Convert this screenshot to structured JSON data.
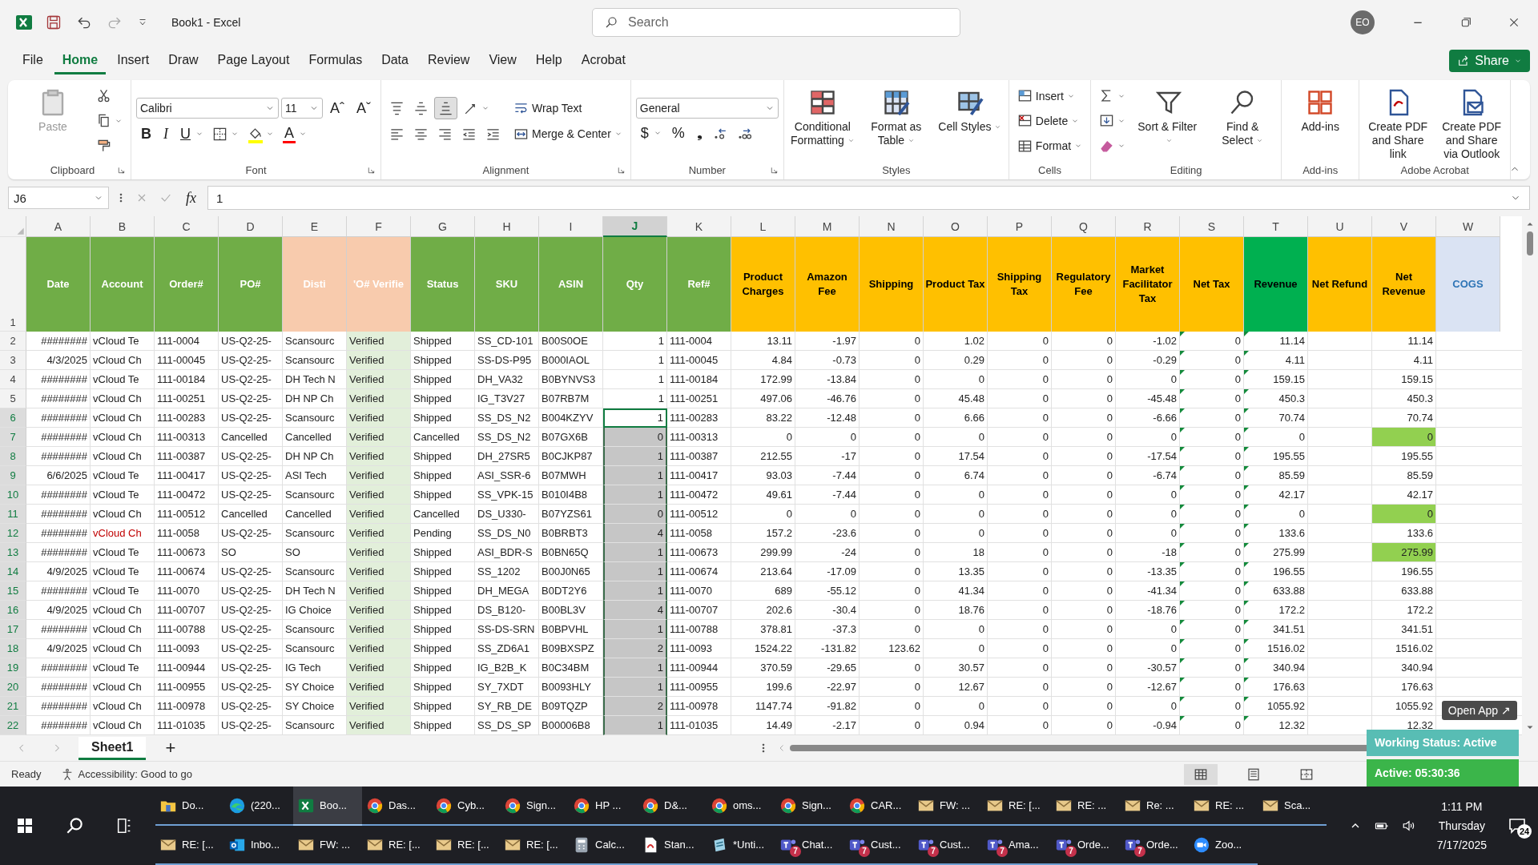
{
  "window": {
    "title": "Book1  -  Excel",
    "search_placeholder": "Search",
    "avatar": "EO"
  },
  "menu_tabs": [
    {
      "label": "File",
      "selected": false
    },
    {
      "label": "Home",
      "selected": true
    },
    {
      "label": "Insert",
      "selected": false
    },
    {
      "label": "Draw",
      "selected": false
    },
    {
      "label": "Page Layout",
      "selected": false
    },
    {
      "label": "Formulas",
      "selected": false
    },
    {
      "label": "Data",
      "selected": false
    },
    {
      "label": "Review",
      "selected": false
    },
    {
      "label": "View",
      "selected": false
    },
    {
      "label": "Help",
      "selected": false
    },
    {
      "label": "Acrobat",
      "selected": false
    }
  ],
  "share_button": "Share",
  "ribbon": {
    "groups": [
      {
        "label": "Clipboard",
        "launcher": true,
        "columns": [
          [
            {
              "kind": "clipboard",
              "label": "Paste",
              "disabled": true
            }
          ],
          [
            {
              "kind": "scissors"
            },
            {
              "kind": "copy",
              "dropdown": true
            },
            {
              "kind": "brush"
            }
          ]
        ]
      },
      {
        "label": "Font",
        "launcher": true,
        "columns": [
          [
            {
              "kind": "row",
              "items": [
                {
                  "kind": "field",
                  "value": "Calibri"
                },
                {
                  "kind": "field",
                  "value": "11"
                },
                {
                  "kind": "grow-font",
                  "glyph": "Aˆ"
                },
                {
                  "kind": "shrink-font",
                  "glyph": "Aˇ"
                }
              ]
            },
            {
              "kind": "row",
              "items": [
                {
                  "kind": "bold",
                  "glyph": "B"
                },
                {
                  "kind": "italic",
                  "glyph": "I"
                },
                {
                  "kind": "underline",
                  "glyph": "U",
                  "dropdown": true
                },
                {
                  "kind": "borders",
                  "dropdown": true
                },
                {
                  "kind": "bucket",
                  "dropdown": true,
                  "color": "#ffff00"
                },
                {
                  "kind": "font-color",
                  "glyph": "A",
                  "dropdown": true,
                  "color": "#ff0000"
                }
              ]
            }
          ]
        ]
      },
      {
        "label": "Alignment",
        "launcher": true,
        "columns": [
          [
            {
              "kind": "row",
              "items": [
                {
                  "kind": "align-top",
                  "pressed": false
                },
                {
                  "kind": "align-middle",
                  "pressed": false
                },
                {
                  "kind": "align-bottom",
                  "pressed": true
                },
                {
                  "kind": "orientation",
                  "dropdown": true
                }
              ]
            },
            {
              "kind": "row",
              "items": [
                {
                  "kind": "align-left"
                },
                {
                  "kind": "align-center"
                },
                {
                  "kind": "align-right"
                },
                {
                  "kind": "outdent"
                },
                {
                  "kind": "indent"
                }
              ]
            }
          ],
          [
            {
              "kind": "wrap",
              "label": "Wrap Text"
            },
            {
              "kind": "merge",
              "label": "Merge & Center",
              "dropdown": true
            }
          ]
        ]
      },
      {
        "label": "Number",
        "launcher": true,
        "columns": [
          [
            {
              "kind": "field",
              "value": "General"
            },
            {
              "kind": "row",
              "items": [
                {
                  "kind": "currency",
                  "glyph": "$",
                  "dropdown": true
                },
                {
                  "kind": "percent",
                  "glyph": "%"
                },
                {
                  "kind": "comma",
                  "glyph": "❟"
                },
                {
                  "kind": "decrease-decimal"
                },
                {
                  "kind": "increase-decimal"
                }
              ]
            }
          ]
        ]
      },
      {
        "label": "Styles",
        "columns": [
          [
            {
              "kind": "conditional-grid",
              "label": "Conditional Formatting",
              "dropdown": true
            }
          ],
          [
            {
              "kind": "table-grid",
              "label": "Format as Table",
              "dropdown": true
            }
          ],
          [
            {
              "kind": "cell-styles",
              "label": "Cell Styles",
              "dropdown": true
            }
          ]
        ]
      },
      {
        "label": "Cells",
        "columns": [
          [
            {
              "kind": "insert-rows",
              "label": "Insert",
              "dropdown": true
            },
            {
              "kind": "delete-rows",
              "label": "Delete",
              "dropdown": true
            },
            {
              "kind": "format-cells",
              "label": "Format",
              "dropdown": true
            }
          ]
        ]
      },
      {
        "label": "Editing",
        "columns": [
          [
            {
              "kind": "sigma",
              "dropdown": true
            },
            {
              "kind": "fill-down",
              "dropdown": true
            },
            {
              "kind": "eraser",
              "dropdown": true
            }
          ],
          [
            {
              "kind": "sort-filter",
              "label": "Sort & Filter",
              "dropdown": true
            }
          ],
          [
            {
              "kind": "magnifier",
              "label": "Find & Select",
              "dropdown": true
            }
          ]
        ]
      },
      {
        "label": "Add-ins",
        "columns": [
          [
            {
              "kind": "tiles",
              "label": "Add-ins"
            }
          ]
        ]
      },
      {
        "label": "Adobe Acrobat",
        "columns": [
          [
            {
              "kind": "document-link",
              "label": "Create PDF and Share link"
            }
          ],
          [
            {
              "kind": "document-mail",
              "label": "Create PDF and Share via Outlook"
            }
          ]
        ]
      }
    ]
  },
  "formula_bar": {
    "name_box": "J6",
    "fx": "fx",
    "formula": "1"
  },
  "columns": [
    {
      "letter": "A",
      "header": {
        "text": "Date",
        "color": "#ffffff"
      },
      "color": "#70ad47",
      "kind": "number",
      "selected": false
    },
    {
      "letter": "B",
      "header": {
        "text": "Account",
        "color": "#ffffff"
      },
      "color": "#70ad47",
      "kind": "text",
      "selected": false
    },
    {
      "letter": "C",
      "header": {
        "text": "Order#",
        "color": "#ffffff"
      },
      "color": "#70ad47",
      "kind": "text",
      "selected": false
    },
    {
      "letter": "D",
      "header": {
        "text": "PO#",
        "color": "#ffffff"
      },
      "color": "#70ad47",
      "kind": "text",
      "selected": false
    },
    {
      "letter": "E",
      "header": {
        "text": "Disti",
        "color": "#ffffff"
      },
      "color": "#f8cbad",
      "kind": "text",
      "selected": false
    },
    {
      "letter": "F",
      "header": {
        "text": "'O# Verifie",
        "color": "#ffffff"
      },
      "color": "#f8cbad",
      "kind": "text",
      "selected": false,
      "body": {
        "color": "#e2efda"
      }
    },
    {
      "letter": "G",
      "header": {
        "text": "Status",
        "color": "#ffffff"
      },
      "color": "#70ad47",
      "kind": "text",
      "selected": false
    },
    {
      "letter": "H",
      "header": {
        "text": "SKU",
        "color": "#ffffff"
      },
      "color": "#70ad47",
      "kind": "text",
      "selected": false
    },
    {
      "letter": "I",
      "header": {
        "text": "ASIN",
        "color": "#ffffff"
      },
      "color": "#70ad47",
      "kind": "text",
      "selected": false
    },
    {
      "letter": "J",
      "header": {
        "text": "Qty",
        "color": "#ffffff"
      },
      "color": "#70ad47",
      "kind": "number",
      "selected": true
    },
    {
      "letter": "K",
      "header": {
        "text": "Ref#",
        "color": "#ffffff"
      },
      "color": "#70ad47",
      "kind": "text",
      "selected": false
    },
    {
      "letter": "L",
      "header": {
        "text": "Product Charges",
        "color": "#000000"
      },
      "color": "#ffc000",
      "kind": "number",
      "selected": false
    },
    {
      "letter": "M",
      "header": {
        "text": "Amazon Fee",
        "color": "#000000"
      },
      "color": "#ffc000",
      "kind": "number",
      "selected": false
    },
    {
      "letter": "N",
      "header": {
        "text": "Shipping",
        "color": "#000000"
      },
      "color": "#ffc000",
      "kind": "number",
      "selected": false
    },
    {
      "letter": "O",
      "header": {
        "text": "Product Tax",
        "color": "#000000"
      },
      "color": "#ffc000",
      "kind": "number",
      "selected": false
    },
    {
      "letter": "P",
      "header": {
        "text": "Shipping Tax",
        "color": "#000000"
      },
      "color": "#ffc000",
      "kind": "number",
      "selected": false
    },
    {
      "letter": "Q",
      "header": {
        "text": "Regulatory Fee",
        "color": "#000000"
      },
      "color": "#ffc000",
      "kind": "number",
      "selected": false
    },
    {
      "letter": "R",
      "header": {
        "text": "Market Facilitator Tax",
        "color": "#000000"
      },
      "color": "#ffc000",
      "kind": "number",
      "selected": false
    },
    {
      "letter": "S",
      "header": {
        "text": "Net Tax",
        "color": "#000000"
      },
      "color": "#ffc000",
      "kind": "number",
      "selected": false,
      "error_marks": true
    },
    {
      "letter": "T",
      "header": {
        "text": "Revenue",
        "color": "#000000"
      },
      "color": "#00b050",
      "kind": "number",
      "selected": false,
      "error_marks": true
    },
    {
      "letter": "U",
      "header": {
        "text": "Net Refund",
        "color": "#000000"
      },
      "color": "#ffc000",
      "kind": "number",
      "selected": false
    },
    {
      "letter": "V",
      "header": {
        "text": "Net Revenue",
        "color": "#000000"
      },
      "color": "#ffc000",
      "kind": "number",
      "selected": false
    },
    {
      "letter": "W",
      "header": {
        "text": "COGS",
        "color": "#2e75b6"
      },
      "color": "#dae3f3",
      "kind": "number",
      "selected": false
    }
  ],
  "header_row": "1",
  "rows": [
    {
      "number": "2",
      "selected": false,
      "active": false,
      "cells": [
        "########",
        "vCloud Te",
        "111-0004",
        "US-Q2-25-",
        "Scansourc",
        "Verified",
        "Shipped",
        "SS_CD-101",
        "B00S0OE",
        "1",
        "111-0004",
        "13.11",
        "-1.97",
        "0",
        "1.02",
        "0",
        "0",
        "-1.02",
        "0",
        "11.14",
        null,
        "11.14",
        null
      ]
    },
    {
      "number": "3",
      "selected": false,
      "active": false,
      "cells": [
        "4/3/2025",
        "vCloud Ch",
        "111-00045",
        "US-Q2-25-",
        "Scansourc",
        "Verified",
        "Shipped",
        "SS-DS-P95",
        "B000IAOL",
        "1",
        "111-00045",
        "4.84",
        "-0.73",
        "0",
        "0.29",
        "0",
        "0",
        "-0.29",
        "0",
        "4.11",
        null,
        "4.11",
        null
      ]
    },
    {
      "number": "4",
      "selected": false,
      "active": false,
      "cells": [
        "########",
        "vCloud Te",
        "111-00184",
        "US-Q2-25-",
        "DH Tech N",
        "Verified",
        "Shipped",
        "DH_VA32",
        "B0BYNVS3",
        "1",
        "111-00184",
        "172.99",
        "-13.84",
        "0",
        "0",
        "0",
        "0",
        "0",
        "0",
        "159.15",
        null,
        "159.15",
        null
      ]
    },
    {
      "number": "5",
      "selected": false,
      "active": false,
      "cells": [
        "########",
        "vCloud Ch",
        "111-00251",
        "US-Q2-25-",
        "DH NP Ch",
        "Verified",
        "Shipped",
        "IG_T3V27",
        "B07RB7M",
        "1",
        "111-00251",
        "497.06",
        "-46.76",
        "0",
        "45.48",
        "0",
        "0",
        "-45.48",
        "0",
        "450.3",
        null,
        "450.3",
        null
      ]
    },
    {
      "number": "6",
      "selected": true,
      "active": true,
      "cells": [
        "########",
        "vCloud Ch",
        "111-00283",
        "US-Q2-25-",
        "Scansourc",
        "Verified",
        "Shipped",
        "SS_DS_N2",
        "B004KZYV",
        "1",
        "111-00283",
        "83.22",
        "-12.48",
        "0",
        "6.66",
        "0",
        "0",
        "-6.66",
        "0",
        "70.74",
        null,
        "70.74",
        null
      ]
    },
    {
      "number": "7",
      "selected": true,
      "active": false,
      "cells": [
        "########",
        "vCloud Ch",
        "111-00313",
        "Cancelled",
        "Cancelled",
        "Verified",
        "Cancelled",
        "SS_DS_N2",
        "B07GX6B",
        "0",
        "111-00313",
        "0",
        "0",
        "0",
        "0",
        "0",
        "0",
        "0",
        "0",
        "0",
        null,
        {
          "text": "0",
          "color": "#92d050",
          "kind": "fill"
        },
        null
      ]
    },
    {
      "number": "8",
      "selected": true,
      "active": false,
      "cells": [
        "########",
        "vCloud Ch",
        "111-00387",
        "US-Q2-25-",
        "DH NP Ch",
        "Verified",
        "Shipped",
        "DH_27SR5",
        "B0CJKP87",
        "1",
        "111-00387",
        "212.55",
        "-17",
        "0",
        "17.54",
        "0",
        "0",
        "-17.54",
        "0",
        "195.55",
        null,
        "195.55",
        null
      ]
    },
    {
      "number": "9",
      "selected": true,
      "active": false,
      "cells": [
        "6/6/2025",
        "vCloud Te",
        "111-00417",
        "US-Q2-25-",
        "ASI Tech",
        "Verified",
        "Shipped",
        "ASI_SSR-6",
        "B07MWH",
        "1",
        "111-00417",
        "93.03",
        "-7.44",
        "0",
        "6.74",
        "0",
        "0",
        "-6.74",
        "0",
        "85.59",
        null,
        "85.59",
        null
      ]
    },
    {
      "number": "10",
      "selected": true,
      "active": false,
      "cells": [
        "########",
        "vCloud Te",
        "111-00472",
        "US-Q2-25-",
        "Scansourc",
        "Verified",
        "Shipped",
        "SS_VPK-15",
        "B010I4B8",
        "1",
        "111-00472",
        "49.61",
        "-7.44",
        "0",
        "0",
        "0",
        "0",
        "0",
        "0",
        "42.17",
        null,
        "42.17",
        null
      ]
    },
    {
      "number": "11",
      "selected": true,
      "active": false,
      "cells": [
        "########",
        "vCloud Ch",
        "111-00512",
        "Cancelled",
        "Cancelled",
        "Verified",
        "Cancelled",
        "DS_U330-",
        "B07YZS61",
        "0",
        "111-00512",
        "0",
        "0",
        "0",
        "0",
        "0",
        "0",
        "0",
        "0",
        "0",
        null,
        {
          "text": "0",
          "color": "#92d050",
          "kind": "fill"
        },
        null
      ]
    },
    {
      "number": "12",
      "selected": true,
      "active": false,
      "cells": [
        "########",
        {
          "text": "vCloud Ch",
          "color": "#c00000",
          "kind": "ink"
        },
        "111-0058",
        "US-Q2-25-",
        "Scansourc",
        "Verified",
        "Pending",
        "SS_DS_N0",
        "B0BRBT3",
        "4",
        "111-0058",
        "157.2",
        "-23.6",
        "0",
        "0",
        "0",
        "0",
        "0",
        "0",
        "133.6",
        null,
        "133.6",
        null
      ]
    },
    {
      "number": "13",
      "selected": true,
      "active": false,
      "cells": [
        "########",
        "vCloud Te",
        "111-00673",
        "SO",
        "SO",
        "Verified",
        "Shipped",
        "ASI_BDR-S",
        "B0BN65Q",
        "1",
        "111-00673",
        "299.99",
        "-24",
        "0",
        "18",
        "0",
        "0",
        "-18",
        "0",
        "275.99",
        null,
        {
          "text": "275.99",
          "color": "#92d050",
          "kind": "fill"
        },
        null
      ]
    },
    {
      "number": "14",
      "selected": true,
      "active": false,
      "cells": [
        "4/9/2025",
        "vCloud Te",
        "111-00674",
        "US-Q2-25-",
        "Scansourc",
        "Verified",
        "Shipped",
        "SS_1202",
        "B00J0N65",
        "1",
        "111-00674",
        "213.64",
        "-17.09",
        "0",
        "13.35",
        "0",
        "0",
        "-13.35",
        "0",
        "196.55",
        null,
        "196.55",
        null
      ]
    },
    {
      "number": "15",
      "selected": true,
      "active": false,
      "cells": [
        "########",
        "vCloud Te",
        "111-0070",
        "US-Q2-25-",
        "DH Tech N",
        "Verified",
        "Shipped",
        "DH_MEGA",
        "B0DT2Y6",
        "1",
        "111-0070",
        "689",
        "-55.12",
        "0",
        "41.34",
        "0",
        "0",
        "-41.34",
        "0",
        "633.88",
        null,
        "633.88",
        null
      ]
    },
    {
      "number": "16",
      "selected": true,
      "active": false,
      "cells": [
        "4/9/2025",
        "vCloud Ch",
        "111-00707",
        "US-Q2-25-",
        "IG Choice",
        "Verified",
        "Shipped",
        "DS_B120-",
        "B00BL3V",
        "4",
        "111-00707",
        "202.6",
        "-30.4",
        "0",
        "18.76",
        "0",
        "0",
        "-18.76",
        "0",
        "172.2",
        null,
        "172.2",
        null
      ]
    },
    {
      "number": "17",
      "selected": true,
      "active": false,
      "cells": [
        "########",
        "vCloud Ch",
        "111-00788",
        "US-Q2-25-",
        "Scansourc",
        "Verified",
        "Shipped",
        "SS-DS-SRN",
        "B0BPVHL",
        "1",
        "111-00788",
        "378.81",
        "-37.3",
        "0",
        "0",
        "0",
        "0",
        "0",
        "0",
        "341.51",
        null,
        "341.51",
        null
      ]
    },
    {
      "number": "18",
      "selected": true,
      "active": false,
      "cells": [
        "4/9/2025",
        "vCloud Ch",
        "111-0093",
        "US-Q2-25-",
        "Scansourc",
        "Verified",
        "Shipped",
        "SS_ZD6A1",
        "B09BXSPZ",
        "2",
        "111-0093",
        "1524.22",
        "-131.82",
        "123.62",
        "0",
        "0",
        "0",
        "0",
        "0",
        "1516.02",
        null,
        "1516.02",
        null
      ]
    },
    {
      "number": "19",
      "selected": true,
      "active": false,
      "cells": [
        "########",
        "vCloud Te",
        "111-00944",
        "US-Q2-25-",
        "IG Tech",
        "Verified",
        "Shipped",
        "IG_B2B_K",
        "B0C34BM",
        "1",
        "111-00944",
        "370.59",
        "-29.65",
        "0",
        "30.57",
        "0",
        "0",
        "-30.57",
        "0",
        "340.94",
        null,
        "340.94",
        null
      ]
    },
    {
      "number": "20",
      "selected": true,
      "active": false,
      "cells": [
        "########",
        "vCloud Ch",
        "111-00955",
        "US-Q2-25-",
        "SY Choice",
        "Verified",
        "Shipped",
        "SY_7XDT",
        "B0093HLY",
        "1",
        "111-00955",
        "199.6",
        "-22.97",
        "0",
        "12.67",
        "0",
        "0",
        "-12.67",
        "0",
        "176.63",
        null,
        "176.63",
        null
      ]
    },
    {
      "number": "21",
      "selected": true,
      "active": false,
      "cells": [
        "########",
        "vCloud Ch",
        "111-00978",
        "US-Q2-25-",
        "SY Choice",
        "Verified",
        "Shipped",
        "SY_RB_DE",
        "B09TQZP",
        "2",
        "111-00978",
        "1147.74",
        "-91.82",
        "0",
        "0",
        "0",
        "0",
        "0",
        "0",
        "1055.92",
        null,
        "1055.92",
        null
      ]
    },
    {
      "number": "22",
      "selected": true,
      "active": false,
      "cells": [
        "########",
        "vCloud Ch",
        "111-01035",
        "US-Q2-25-",
        "Scansourc",
        "Verified",
        "Shipped",
        "SS_DS_SP",
        "B00006B8",
        "1",
        "111-01035",
        "14.49",
        "-2.17",
        "0",
        "0.94",
        "0",
        "0",
        "-0.94",
        "0",
        "12.32",
        null,
        "12.32",
        null
      ]
    }
  ],
  "sheet_tabs": [
    {
      "label": "Sheet1",
      "selected": true
    }
  ],
  "add_sheet": "+",
  "status_bar": {
    "ready": "Ready",
    "accessibility": "Accessibility: Good to go"
  },
  "view_buttons": [
    {
      "kind": "normal",
      "selected": true
    },
    {
      "kind": "page-layout",
      "selected": false
    },
    {
      "kind": "page-break",
      "selected": false
    }
  ],
  "tracker": {
    "open_app": "Open App ↗",
    "status": "Working Status: Active",
    "timer": "Active: 05:30:36"
  },
  "taskbar": {
    "rows": [
      [
        {
          "label": "Do...",
          "kind": "folder",
          "selected": false
        },
        {
          "label": "(220...",
          "kind": "edge",
          "selected": false
        },
        {
          "label": "Boo...",
          "kind": "excel",
          "selected": true
        },
        {
          "label": "Das...",
          "kind": "chrome",
          "selected": false
        },
        {
          "label": "Cyb...",
          "kind": "chrome",
          "selected": false
        },
        {
          "label": "Sign...",
          "kind": "chrome",
          "selected": false
        },
        {
          "label": "HP ...",
          "kind": "chrome",
          "selected": false
        },
        {
          "label": "D&...",
          "kind": "chrome",
          "selected": false
        },
        {
          "label": "oms...",
          "kind": "chrome",
          "selected": false
        },
        {
          "label": "Sign...",
          "kind": "chrome",
          "selected": false
        },
        {
          "label": "CAR...",
          "kind": "chrome",
          "selected": false
        },
        {
          "label": "FW: ...",
          "kind": "mail",
          "selected": false
        },
        {
          "label": "RE: [...",
          "kind": "mail",
          "selected": false
        },
        {
          "label": "RE: ...",
          "kind": "mail",
          "selected": false
        },
        {
          "label": "Re: ...",
          "kind": "mail",
          "selected": false
        },
        {
          "label": "RE: ...",
          "kind": "mail",
          "selected": false
        },
        {
          "label": "Sca...",
          "kind": "mail",
          "selected": false
        }
      ],
      [
        {
          "label": "RE: [...",
          "kind": "mail",
          "selected": false
        },
        {
          "label": "Inbo...",
          "kind": "outlook",
          "selected": false
        },
        {
          "label": "FW: ...",
          "kind": "mail",
          "selected": false
        },
        {
          "label": "RE: [...",
          "kind": "mail",
          "selected": false
        },
        {
          "label": "RE: [...",
          "kind": "mail",
          "selected": false
        },
        {
          "label": "RE: [...",
          "kind": "mail",
          "selected": false
        },
        {
          "label": "Calc...",
          "kind": "calculator",
          "selected": false
        },
        {
          "label": "Stan...",
          "kind": "pdf",
          "selected": false
        },
        {
          "label": "*Unti...",
          "kind": "notepad",
          "selected": false
        },
        {
          "label": "Chat...",
          "kind": "teams",
          "selected": false,
          "badge": "7"
        },
        {
          "label": "Cust...",
          "kind": "teams",
          "selected": false,
          "badge": "7"
        },
        {
          "label": "Cust...",
          "kind": "teams",
          "selected": false,
          "badge": "7"
        },
        {
          "label": "Ama...",
          "kind": "teams",
          "selected": false,
          "badge": "7"
        },
        {
          "label": "Orde...",
          "kind": "teams",
          "selected": false,
          "badge": "7"
        },
        {
          "label": "Orde...",
          "kind": "teams",
          "selected": false,
          "badge": "7"
        },
        {
          "label": "Zoo...",
          "kind": "zoom",
          "selected": false
        }
      ]
    ],
    "time": "1:11 PM",
    "day": "Thursday",
    "date": "7/17/2025",
    "notifications": "24"
  }
}
